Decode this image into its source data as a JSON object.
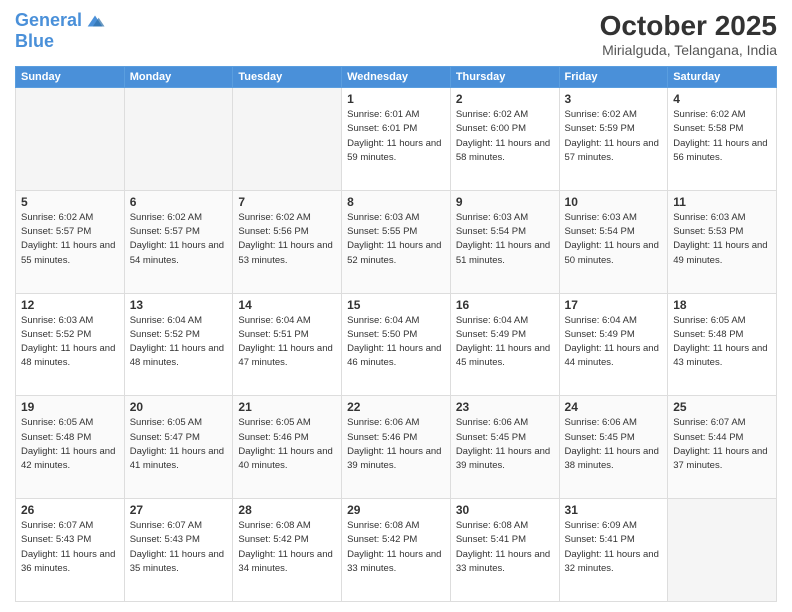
{
  "logo": {
    "line1": "General",
    "line2": "Blue"
  },
  "title": "October 2025",
  "location": "Mirialguda, Telangana, India",
  "headers": [
    "Sunday",
    "Monday",
    "Tuesday",
    "Wednesday",
    "Thursday",
    "Friday",
    "Saturday"
  ],
  "weeks": [
    [
      {
        "day": "",
        "info": ""
      },
      {
        "day": "",
        "info": ""
      },
      {
        "day": "",
        "info": ""
      },
      {
        "day": "1",
        "sunrise": "Sunrise: 6:01 AM",
        "sunset": "Sunset: 6:01 PM",
        "daylight": "Daylight: 11 hours and 59 minutes."
      },
      {
        "day": "2",
        "sunrise": "Sunrise: 6:02 AM",
        "sunset": "Sunset: 6:00 PM",
        "daylight": "Daylight: 11 hours and 58 minutes."
      },
      {
        "day": "3",
        "sunrise": "Sunrise: 6:02 AM",
        "sunset": "Sunset: 5:59 PM",
        "daylight": "Daylight: 11 hours and 57 minutes."
      },
      {
        "day": "4",
        "sunrise": "Sunrise: 6:02 AM",
        "sunset": "Sunset: 5:58 PM",
        "daylight": "Daylight: 11 hours and 56 minutes."
      }
    ],
    [
      {
        "day": "5",
        "sunrise": "Sunrise: 6:02 AM",
        "sunset": "Sunset: 5:57 PM",
        "daylight": "Daylight: 11 hours and 55 minutes."
      },
      {
        "day": "6",
        "sunrise": "Sunrise: 6:02 AM",
        "sunset": "Sunset: 5:57 PM",
        "daylight": "Daylight: 11 hours and 54 minutes."
      },
      {
        "day": "7",
        "sunrise": "Sunrise: 6:02 AM",
        "sunset": "Sunset: 5:56 PM",
        "daylight": "Daylight: 11 hours and 53 minutes."
      },
      {
        "day": "8",
        "sunrise": "Sunrise: 6:03 AM",
        "sunset": "Sunset: 5:55 PM",
        "daylight": "Daylight: 11 hours and 52 minutes."
      },
      {
        "day": "9",
        "sunrise": "Sunrise: 6:03 AM",
        "sunset": "Sunset: 5:54 PM",
        "daylight": "Daylight: 11 hours and 51 minutes."
      },
      {
        "day": "10",
        "sunrise": "Sunrise: 6:03 AM",
        "sunset": "Sunset: 5:54 PM",
        "daylight": "Daylight: 11 hours and 50 minutes."
      },
      {
        "day": "11",
        "sunrise": "Sunrise: 6:03 AM",
        "sunset": "Sunset: 5:53 PM",
        "daylight": "Daylight: 11 hours and 49 minutes."
      }
    ],
    [
      {
        "day": "12",
        "sunrise": "Sunrise: 6:03 AM",
        "sunset": "Sunset: 5:52 PM",
        "daylight": "Daylight: 11 hours and 48 minutes."
      },
      {
        "day": "13",
        "sunrise": "Sunrise: 6:04 AM",
        "sunset": "Sunset: 5:52 PM",
        "daylight": "Daylight: 11 hours and 48 minutes."
      },
      {
        "day": "14",
        "sunrise": "Sunrise: 6:04 AM",
        "sunset": "Sunset: 5:51 PM",
        "daylight": "Daylight: 11 hours and 47 minutes."
      },
      {
        "day": "15",
        "sunrise": "Sunrise: 6:04 AM",
        "sunset": "Sunset: 5:50 PM",
        "daylight": "Daylight: 11 hours and 46 minutes."
      },
      {
        "day": "16",
        "sunrise": "Sunrise: 6:04 AM",
        "sunset": "Sunset: 5:49 PM",
        "daylight": "Daylight: 11 hours and 45 minutes."
      },
      {
        "day": "17",
        "sunrise": "Sunrise: 6:04 AM",
        "sunset": "Sunset: 5:49 PM",
        "daylight": "Daylight: 11 hours and 44 minutes."
      },
      {
        "day": "18",
        "sunrise": "Sunrise: 6:05 AM",
        "sunset": "Sunset: 5:48 PM",
        "daylight": "Daylight: 11 hours and 43 minutes."
      }
    ],
    [
      {
        "day": "19",
        "sunrise": "Sunrise: 6:05 AM",
        "sunset": "Sunset: 5:48 PM",
        "daylight": "Daylight: 11 hours and 42 minutes."
      },
      {
        "day": "20",
        "sunrise": "Sunrise: 6:05 AM",
        "sunset": "Sunset: 5:47 PM",
        "daylight": "Daylight: 11 hours and 41 minutes."
      },
      {
        "day": "21",
        "sunrise": "Sunrise: 6:05 AM",
        "sunset": "Sunset: 5:46 PM",
        "daylight": "Daylight: 11 hours and 40 minutes."
      },
      {
        "day": "22",
        "sunrise": "Sunrise: 6:06 AM",
        "sunset": "Sunset: 5:46 PM",
        "daylight": "Daylight: 11 hours and 39 minutes."
      },
      {
        "day": "23",
        "sunrise": "Sunrise: 6:06 AM",
        "sunset": "Sunset: 5:45 PM",
        "daylight": "Daylight: 11 hours and 39 minutes."
      },
      {
        "day": "24",
        "sunrise": "Sunrise: 6:06 AM",
        "sunset": "Sunset: 5:45 PM",
        "daylight": "Daylight: 11 hours and 38 minutes."
      },
      {
        "day": "25",
        "sunrise": "Sunrise: 6:07 AM",
        "sunset": "Sunset: 5:44 PM",
        "daylight": "Daylight: 11 hours and 37 minutes."
      }
    ],
    [
      {
        "day": "26",
        "sunrise": "Sunrise: 6:07 AM",
        "sunset": "Sunset: 5:43 PM",
        "daylight": "Daylight: 11 hours and 36 minutes."
      },
      {
        "day": "27",
        "sunrise": "Sunrise: 6:07 AM",
        "sunset": "Sunset: 5:43 PM",
        "daylight": "Daylight: 11 hours and 35 minutes."
      },
      {
        "day": "28",
        "sunrise": "Sunrise: 6:08 AM",
        "sunset": "Sunset: 5:42 PM",
        "daylight": "Daylight: 11 hours and 34 minutes."
      },
      {
        "day": "29",
        "sunrise": "Sunrise: 6:08 AM",
        "sunset": "Sunset: 5:42 PM",
        "daylight": "Daylight: 11 hours and 33 minutes."
      },
      {
        "day": "30",
        "sunrise": "Sunrise: 6:08 AM",
        "sunset": "Sunset: 5:41 PM",
        "daylight": "Daylight: 11 hours and 33 minutes."
      },
      {
        "day": "31",
        "sunrise": "Sunrise: 6:09 AM",
        "sunset": "Sunset: 5:41 PM",
        "daylight": "Daylight: 11 hours and 32 minutes."
      },
      {
        "day": "",
        "info": ""
      }
    ]
  ]
}
